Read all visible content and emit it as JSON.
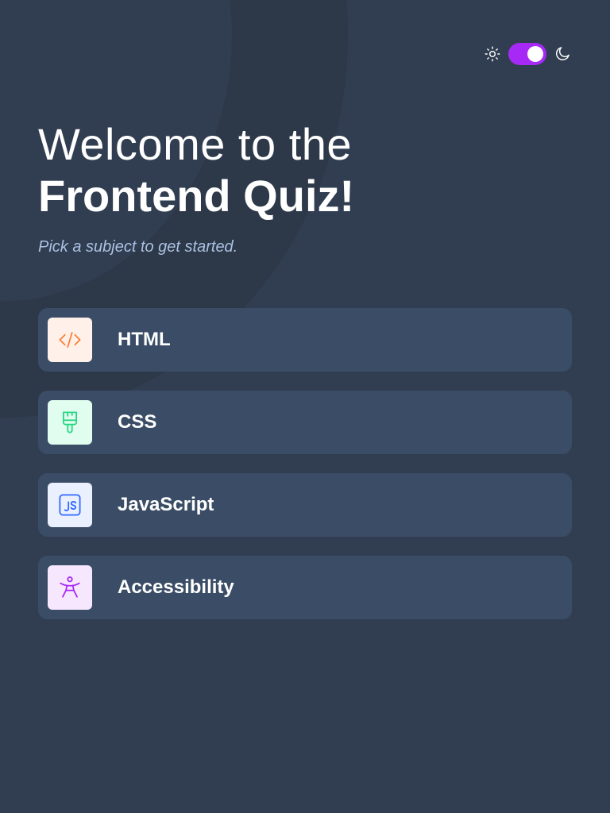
{
  "header": {
    "toggle": {
      "light_icon": "sun-icon",
      "dark_icon": "moon-icon",
      "state": "dark",
      "accent": "#a729f5"
    }
  },
  "hero": {
    "title_line1": "Welcome to the",
    "title_line2": "Frontend Quiz!",
    "subtitle": "Pick a subject to get started."
  },
  "subjects": [
    {
      "label": "HTML",
      "icon": "code-icon",
      "icon_color": "#ff7e35",
      "badge_bg": "#fff1e9"
    },
    {
      "label": "CSS",
      "icon": "paintbrush-icon",
      "icon_color": "#26d782",
      "badge_bg": "#e0fdef"
    },
    {
      "label": "JavaScript",
      "icon": "js-icon",
      "icon_color": "#306aff",
      "badge_bg": "#ebf0ff"
    },
    {
      "label": "Accessibility",
      "icon": "accessibility-icon",
      "icon_color": "#a729f5",
      "badge_bg": "#f6e7ff"
    }
  ],
  "colors": {
    "background": "#313e51",
    "card": "#3b4d66",
    "subtitle": "#abc1e1"
  }
}
